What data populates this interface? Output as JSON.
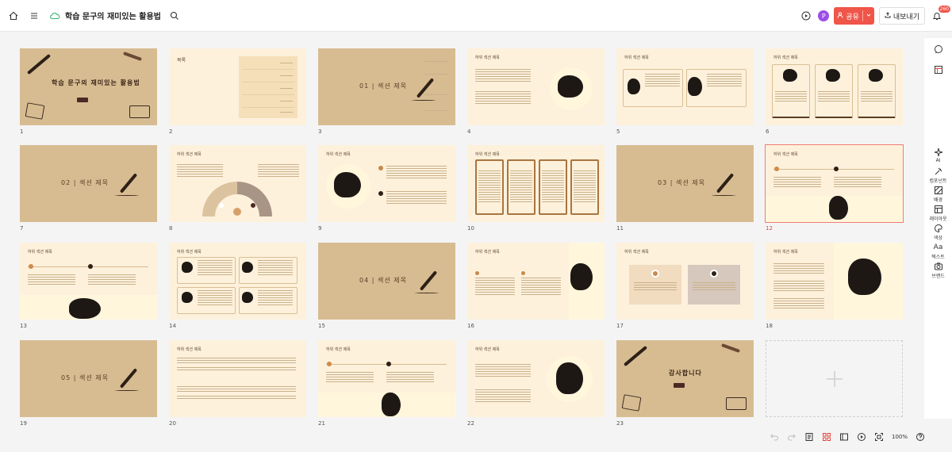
{
  "topbar": {
    "home_icon": "home-icon",
    "menu_icon": "hamburger-icon",
    "cloud_icon": "cloud-saved-icon",
    "doc_title": "학습 문구의 재미있는 활용법",
    "search_icon": "search-icon",
    "play_icon": "play-icon",
    "avatar_letter": "P",
    "share_label": "공유",
    "export_label": "내보내기",
    "notif_badge": "260"
  },
  "slides": [
    {
      "num": "1",
      "type": "cover",
      "title": "학습 문구의 재미있는 활용법"
    },
    {
      "num": "2",
      "type": "toc",
      "title": "목록",
      "items": [
        "01",
        "02",
        "03",
        "04",
        "05"
      ],
      "item_label": "섹션 제목"
    },
    {
      "num": "3",
      "type": "section",
      "title": "01 | 섹션 제목",
      "items": [
        "섹션 하위 항목",
        "섹션 하위 항목",
        "섹션 하위 항목",
        "섹션 하위 항목"
      ]
    },
    {
      "num": "4",
      "type": "content",
      "title": "하위 섹션 제목"
    },
    {
      "num": "5",
      "type": "content",
      "title": "하위 섹션 제목"
    },
    {
      "num": "6",
      "type": "content",
      "title": "하위 섹션 제목"
    },
    {
      "num": "7",
      "type": "section",
      "title": "02 | 섹션 제목"
    },
    {
      "num": "8",
      "type": "content",
      "title": "하위 섹션 제목"
    },
    {
      "num": "9",
      "type": "content",
      "title": "하위 섹션 제목"
    },
    {
      "num": "10",
      "type": "content",
      "title": "하위 섹션 제목"
    },
    {
      "num": "11",
      "type": "section",
      "title": "03 | 섹션 제목"
    },
    {
      "num": "12",
      "type": "content",
      "title": "하위 섹션 제목",
      "selected": true
    },
    {
      "num": "13",
      "type": "content",
      "title": "하위 섹션 제목"
    },
    {
      "num": "14",
      "type": "content",
      "title": "하위 섹션 제목"
    },
    {
      "num": "15",
      "type": "section",
      "title": "04 | 섹션 제목"
    },
    {
      "num": "16",
      "type": "content",
      "title": "하위 섹션 제목"
    },
    {
      "num": "17",
      "type": "content",
      "title": "하위 섹션 제목"
    },
    {
      "num": "18",
      "type": "content",
      "title": "하위 섹션 제목"
    },
    {
      "num": "19",
      "type": "section",
      "title": "05 | 섹션 제목"
    },
    {
      "num": "20",
      "type": "content",
      "title": "하위 섹션 제목"
    },
    {
      "num": "21",
      "type": "content",
      "title": "하위 섹션 제목"
    },
    {
      "num": "22",
      "type": "content",
      "title": "하위 섹션 제목"
    },
    {
      "num": "23",
      "type": "closing",
      "title": "감사합니다"
    }
  ],
  "right_panel": [
    {
      "icon": "comment-icon",
      "label": ""
    },
    {
      "icon": "layout-icon",
      "label": ""
    },
    {
      "icon": "ai-sparkle-icon",
      "label": "AI"
    },
    {
      "icon": "tools-icon",
      "label": "컴포넌트"
    },
    {
      "icon": "background-icon",
      "label": "배경"
    },
    {
      "icon": "layout-grid-icon",
      "label": "레이아웃"
    },
    {
      "icon": "palette-icon",
      "label": "색상"
    },
    {
      "icon": "text-icon",
      "label": "텍스트",
      "glyph": "Aa"
    },
    {
      "icon": "camera-icon",
      "label": "브랜드"
    }
  ],
  "bottombar": {
    "undo_icon": "undo-icon",
    "redo_icon": "redo-icon",
    "notes_icon": "notes-icon",
    "grid_view_icon": "grid-view-icon",
    "list_view_icon": "list-view-icon",
    "present_icon": "present-icon",
    "fit_icon": "fit-screen-icon",
    "zoom": "100%",
    "help_icon": "help-icon"
  },
  "colors": {
    "accent": "#f0554a",
    "kraft": "#d7bc92",
    "cream": "#fdf1dc",
    "ink": "#2d2016"
  }
}
